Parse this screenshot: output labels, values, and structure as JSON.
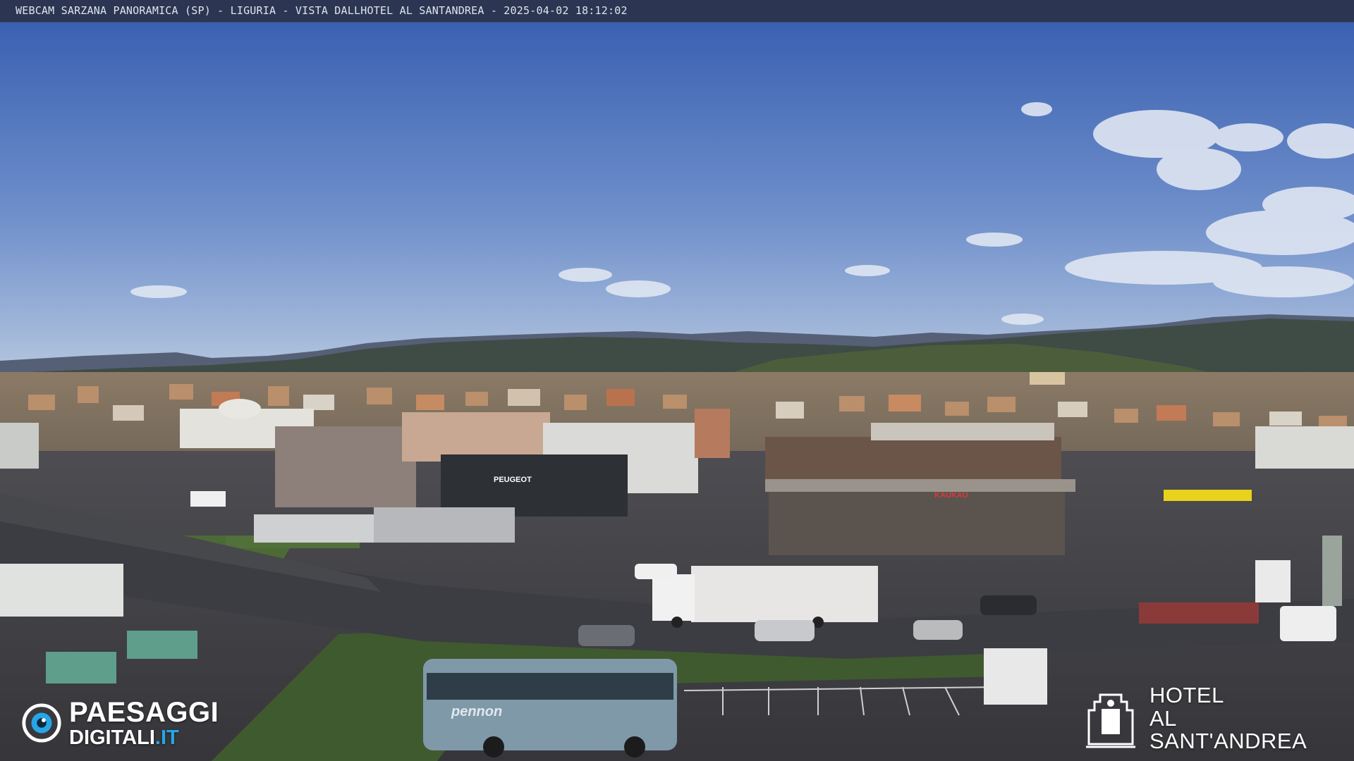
{
  "overlay": {
    "caption": "WEBCAM SARZANA PANORAMICA (SP) - LIGURIA - VISTA DALLHOTEL AL SANTANDREA - 2025-04-02  18:12:02"
  },
  "watermark_left": {
    "brand_top": "PAESAGGI",
    "brand_bottom": "DIGITALI",
    "brand_suffix": ".IT",
    "icon": "eye-logo-icon"
  },
  "watermark_right": {
    "line1": "HOTEL",
    "line2": "AL SANT'ANDREA",
    "icon": "hotel-crest-icon"
  },
  "scene": {
    "description_free": true,
    "signs": [
      "PEUGEOT",
      "KAUKAU",
      "pennon"
    ]
  },
  "colors": {
    "sky_top": "#3b63b4",
    "sky_bottom": "#a9bedd",
    "hills": "#3e4a44",
    "road": "#3a3b3f",
    "accent_blue": "#27a6e6"
  }
}
